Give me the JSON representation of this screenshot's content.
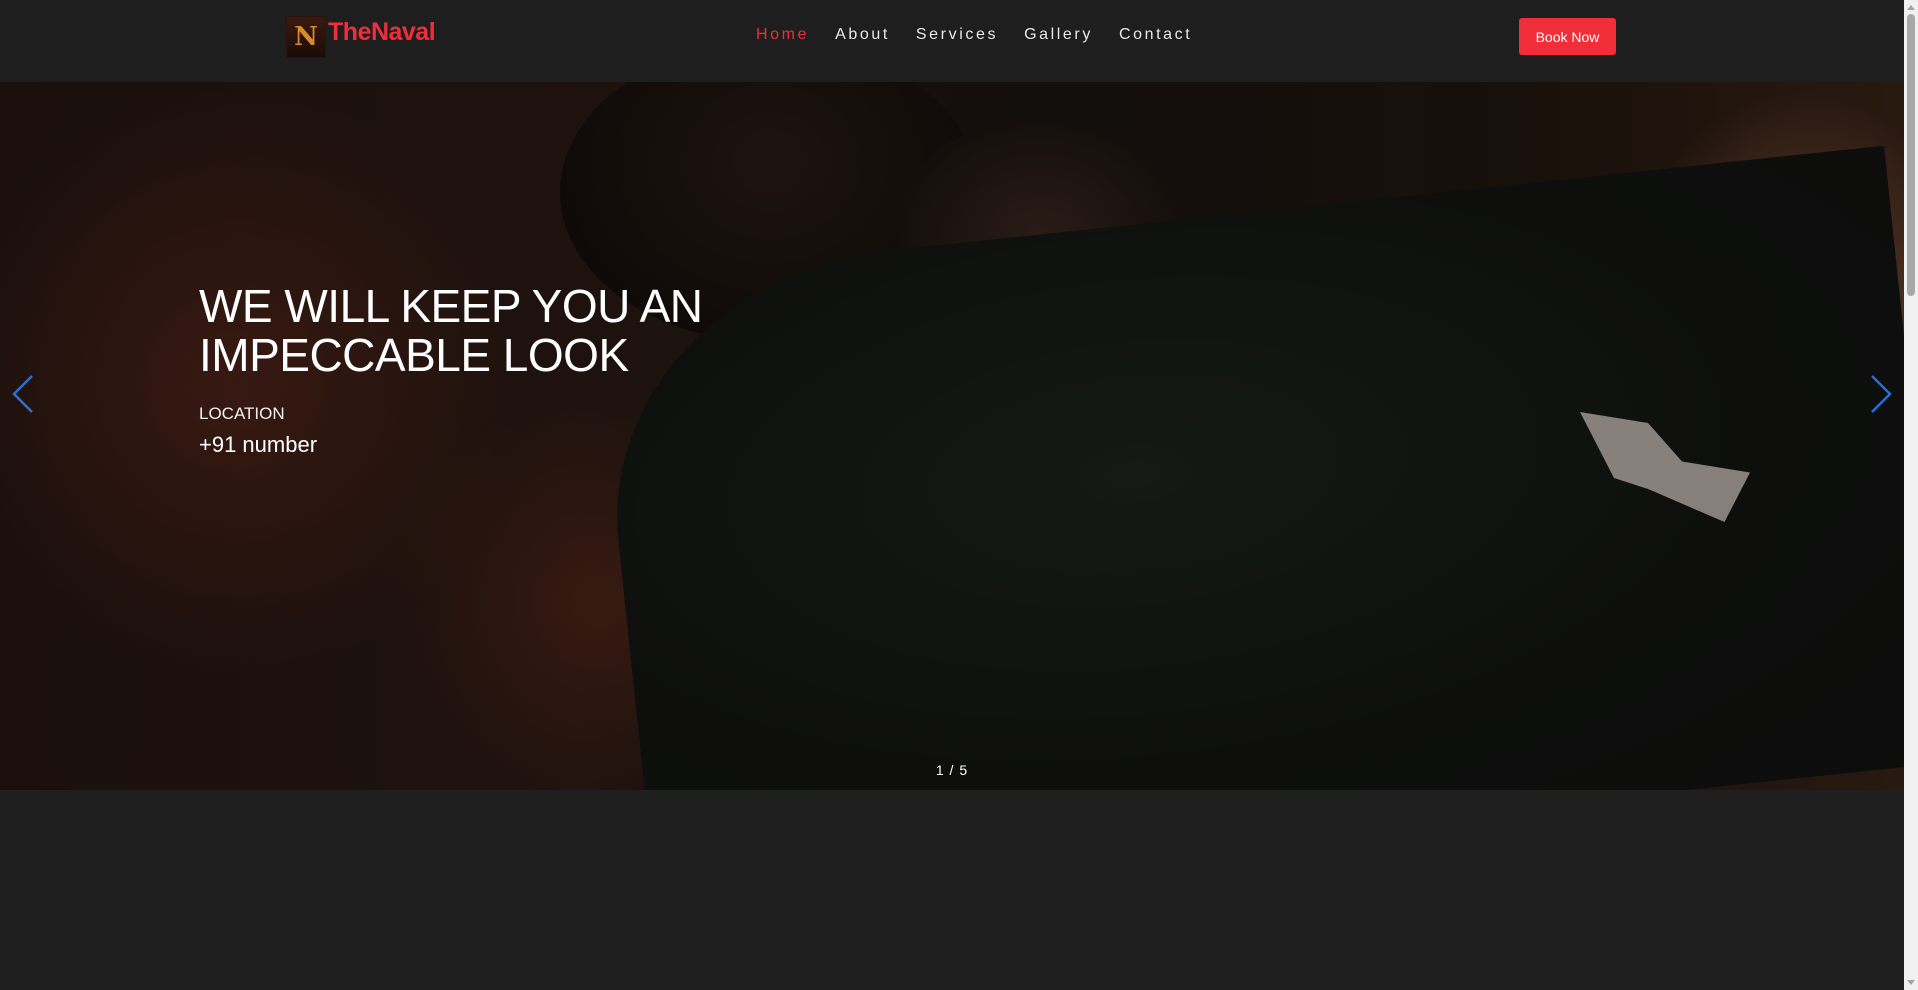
{
  "header": {
    "brand_logo_letter": "N",
    "brand_name": "TheNaval",
    "nav": [
      {
        "label": "Home",
        "active": true
      },
      {
        "label": "About",
        "active": false
      },
      {
        "label": "Services",
        "active": false
      },
      {
        "label": "Gallery",
        "active": false
      },
      {
        "label": "Contact",
        "active": false
      }
    ],
    "book_button": "Book Now"
  },
  "hero": {
    "title": "WE WILL KEEP YOU AN IMPECCABLE LOOK",
    "location": "LOCATION",
    "phone": "+91 number",
    "counter": "1 / 5",
    "prev_icon": "chevron-left-icon",
    "next_icon": "chevron-right-icon"
  },
  "colors": {
    "accent": "#f12d3a",
    "background": "#1f1f1f",
    "arrow": "#2a6fd6"
  }
}
